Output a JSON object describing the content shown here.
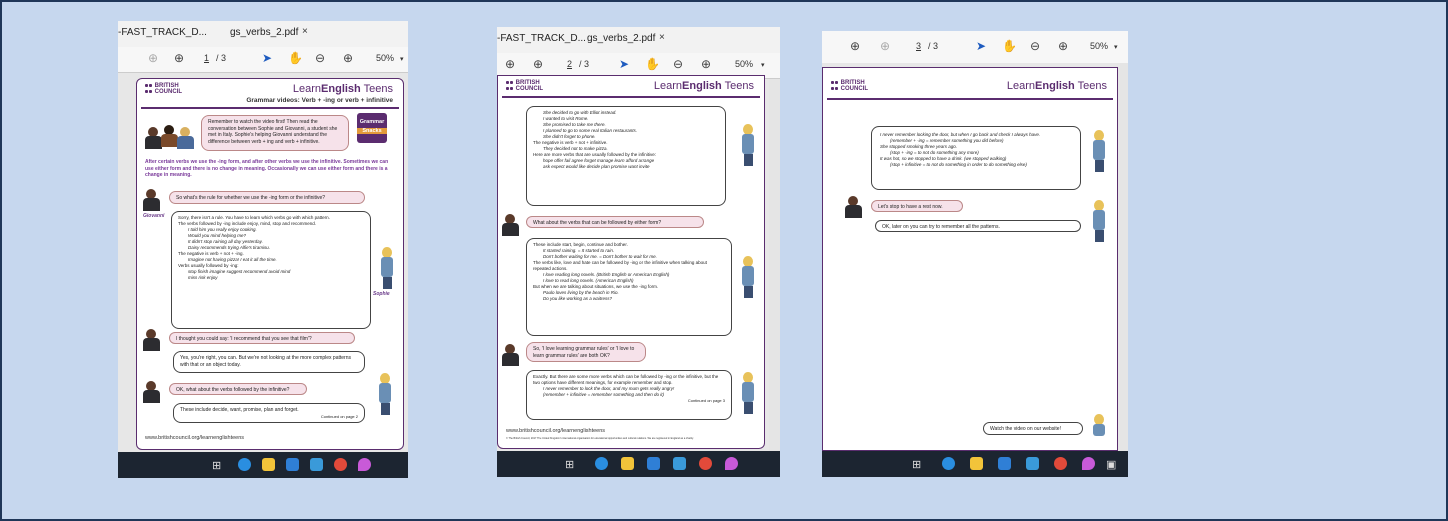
{
  "colors": {
    "background": "#c6d7ee",
    "border": "#1f3658",
    "brand_purple": "#5b2c6f",
    "taskbar": "#1c2531",
    "pink_bubble": "#f6e2ea"
  },
  "icons": [
    "scroll-up-icon",
    "scroll-down-icon",
    "pointer-icon",
    "hand-icon",
    "zoom-out-icon",
    "zoom-in-icon",
    "close-icon",
    "dropdown-icon",
    "task-view-icon",
    "edge-icon",
    "file-explorer-icon",
    "mail-icon",
    "l-app-icon",
    "chrome-icon",
    "paint-icon"
  ],
  "shot1": {
    "tab_prev": "-FAST_TRACK_D...",
    "tab_active": "gs_verbs_2.pdf",
    "tab_close": "×",
    "page_current": "1",
    "page_total": "/ 3",
    "zoom": "50%",
    "brand": "BRITISH\nCOUNCIL",
    "brand_a": "BRITISH",
    "brand_b": "COUNCIL",
    "logo_left": "Learn",
    "logo_mid": "English",
    "logo_right": " Teens",
    "subtitle": "Grammar videos: Verb + -ing or verb + infinitive",
    "intro": "Remember to watch the video first! Then read the conversation between Sophie and Giovanni, a student she met in Italy. Sophie's helping Giovanni understand the difference between verb + ing and verb + infinitive.",
    "badge1": "Grammar",
    "badge2": "Snacks",
    "summary": "After certain verbs we use the -ing form, and after other verbs we use the infinitive. Sometimes we can use either form and there is no change in meaning. Occasionally we can use either form and there is a change in meaning.",
    "q1": "So what's the rule for whether we use the -ing form or the infinitive?",
    "giovanni": "Giovanni",
    "a1_lines": [
      "Sorry, there isn't a rule. You have to learn which verbs go with which pattern.",
      "The verbs followed by -ing include enjoy, mind, stop and recommend.",
      "I told him you really enjoy cooking.",
      "Would you mind helping me?",
      "It didn't stop raining all day yesterday.",
      "Daisy recommends trying Alfie's tiramisu.",
      "The negative is verb + not + -ing.",
      "Imagine not having pizza! I eat it all the time.",
      "Verbs usually followed by -ing:",
      "stop  finish  imagine  suggest  recommend  avoid  mind",
      "miss  risk  enjoy"
    ],
    "sophie": "Sophie",
    "q2": "I thought you could say: 'I recommend that you see that film'?",
    "a2": "Yes, you're right, you can. But we're not looking at the more complex patterns with that or an object today.",
    "q3": "OK, what about the verbs followed by the infinitive?",
    "a3": "These include decide, want, promise, plan and forget.",
    "cont": "Continued on page 2",
    "url": "www.britishcouncil.org/learnenglishteens"
  },
  "shot2": {
    "tab_prev": "-FAST_TRACK_D...",
    "tab_active": "gs_verbs_2.pdf",
    "tab_close": "×",
    "page_current": "2",
    "page_total": "/ 3",
    "zoom": "50%",
    "brand_a": "BRITISH",
    "brand_b": "COUNCIL",
    "logo_left": "Learn",
    "logo_mid": "English",
    "logo_right": " Teens",
    "b1_lines": [
      "She decided to go with Elliot instead.",
      "I wanted to visit Rome.",
      "She promised to take me there.",
      "I planned to go to some real Italian restaurants.",
      "She didn't forget to phone.",
      "The negative is verb + not + infinitive.",
      "They decided not to make pizza.",
      "Here are more verbs that are usually followed by the infinitive:",
      "hope  offer  fail  agree  forget  manage  learn  afford  arrange",
      "ask  expect  would like  decide  plan  promise  want  invite"
    ],
    "q1": "What about the verbs that can be followed by either form?",
    "b2_lines": [
      "These include start, begin, continue and bother.",
      "It started raining. = It started to rain.",
      "Don't bother waiting for me. = Don't bother to wait for me.",
      "The verbs like, love and hate can be followed by -ing or the infinitive when talking about repeated actions.",
      "I love reading long novels. (British English or American English)",
      "I love to read long novels. (American English)",
      "But when we are talking about situations, we use the -ing form.",
      "Paulo loves living by the beach in Rio.",
      "Do you like working as a waitress?"
    ],
    "q2": "So, 'I love learning grammar rules' or 'I love to learn grammar rules' are both OK?",
    "b3_lines": [
      "Exactly. But there are some more verbs which can be followed by -ing or the infinitive, but the two options have different meanings, for example remember and stop.",
      "I never remember to lock the door, and my mum gets really angry!",
      "(remember + infinitive = remember something and then do it)"
    ],
    "cont": "Continued on page 3",
    "url": "www.britishcouncil.org/learnenglishteens",
    "copyright": "© The British Council, 2017 The United Kingdom's international organisation for educational opportunities and cultural relations. We are registered in England as a charity."
  },
  "shot3": {
    "page_current": "3",
    "page_total": "/ 3",
    "zoom": "50%",
    "brand_a": "BRITISH",
    "brand_b": "COUNCIL",
    "logo_left": "Learn",
    "logo_mid": "English",
    "logo_right": " Teens",
    "b1_lines": [
      "I never remember locking the door, but when I go back and check I always have.",
      "(remember + -ing = remember something you did before)",
      "She stopped smoking three years ago.",
      "(stop + -ing = to not do something any more)",
      "It was hot, so we stopped to have a drink. (we stopped walking)",
      "(stop + infinitive = to not do something in order to do something else)"
    ],
    "q1": "Let's stop to have a rest now.",
    "a1": "OK, later on you can try to remember all the patterns.",
    "video": "Watch the video on our website!"
  }
}
